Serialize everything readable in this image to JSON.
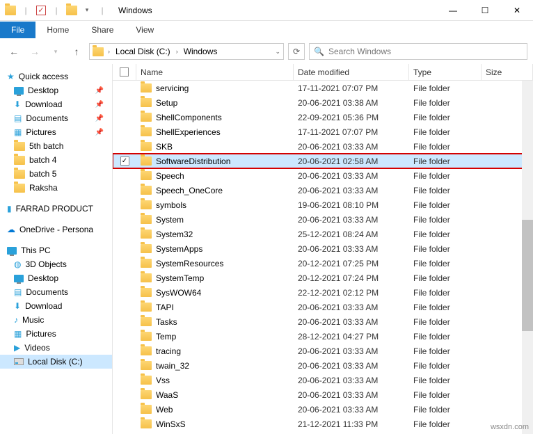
{
  "title": "Windows",
  "ribbon": {
    "file": "File",
    "tabs": [
      "Home",
      "Share",
      "View"
    ]
  },
  "breadcrumb": [
    "Local Disk (C:)",
    "Windows"
  ],
  "search_placeholder": "Search Windows",
  "sidebar": {
    "quick": "Quick access",
    "pinned": [
      "Desktop",
      "Download",
      "Documents",
      "Pictures"
    ],
    "recent": [
      "5th batch",
      "batch 4",
      "batch 5",
      "Raksha"
    ],
    "farrad": "FARRAD PRODUCT",
    "onedrive": "OneDrive - Persona",
    "thispc": "This PC",
    "pc": [
      "3D Objects",
      "Desktop",
      "Documents",
      "Download",
      "Music",
      "Pictures",
      "Videos",
      "Local Disk (C:)"
    ]
  },
  "columns": {
    "name": "Name",
    "date": "Date modified",
    "type": "Type",
    "size": "Size"
  },
  "type_label": "File folder",
  "files": [
    {
      "name": "servicing",
      "date": "17-11-2021 07:07 PM"
    },
    {
      "name": "Setup",
      "date": "20-06-2021 03:38 AM"
    },
    {
      "name": "ShellComponents",
      "date": "22-09-2021 05:36 PM"
    },
    {
      "name": "ShellExperiences",
      "date": "17-11-2021 07:07 PM"
    },
    {
      "name": "SKB",
      "date": "20-06-2021 03:33 AM"
    },
    {
      "name": "SoftwareDistribution",
      "date": "20-06-2021 02:58 AM",
      "selected": true
    },
    {
      "name": "Speech",
      "date": "20-06-2021 03:33 AM"
    },
    {
      "name": "Speech_OneCore",
      "date": "20-06-2021 03:33 AM"
    },
    {
      "name": "symbols",
      "date": "19-06-2021 08:10 PM"
    },
    {
      "name": "System",
      "date": "20-06-2021 03:33 AM"
    },
    {
      "name": "System32",
      "date": "25-12-2021 08:24 AM"
    },
    {
      "name": "SystemApps",
      "date": "20-06-2021 03:33 AM"
    },
    {
      "name": "SystemResources",
      "date": "20-12-2021 07:25 PM"
    },
    {
      "name": "SystemTemp",
      "date": "20-12-2021 07:24 PM"
    },
    {
      "name": "SysWOW64",
      "date": "22-12-2021 02:12 PM"
    },
    {
      "name": "TAPI",
      "date": "20-06-2021 03:33 AM"
    },
    {
      "name": "Tasks",
      "date": "20-06-2021 03:33 AM"
    },
    {
      "name": "Temp",
      "date": "28-12-2021 04:27 PM"
    },
    {
      "name": "tracing",
      "date": "20-06-2021 03:33 AM"
    },
    {
      "name": "twain_32",
      "date": "20-06-2021 03:33 AM"
    },
    {
      "name": "Vss",
      "date": "20-06-2021 03:33 AM"
    },
    {
      "name": "WaaS",
      "date": "20-06-2021 03:33 AM"
    },
    {
      "name": "Web",
      "date": "20-06-2021 03:33 AM"
    },
    {
      "name": "WinSxS",
      "date": "21-12-2021 11:33 PM"
    }
  ],
  "watermark": "wsxdn.com"
}
